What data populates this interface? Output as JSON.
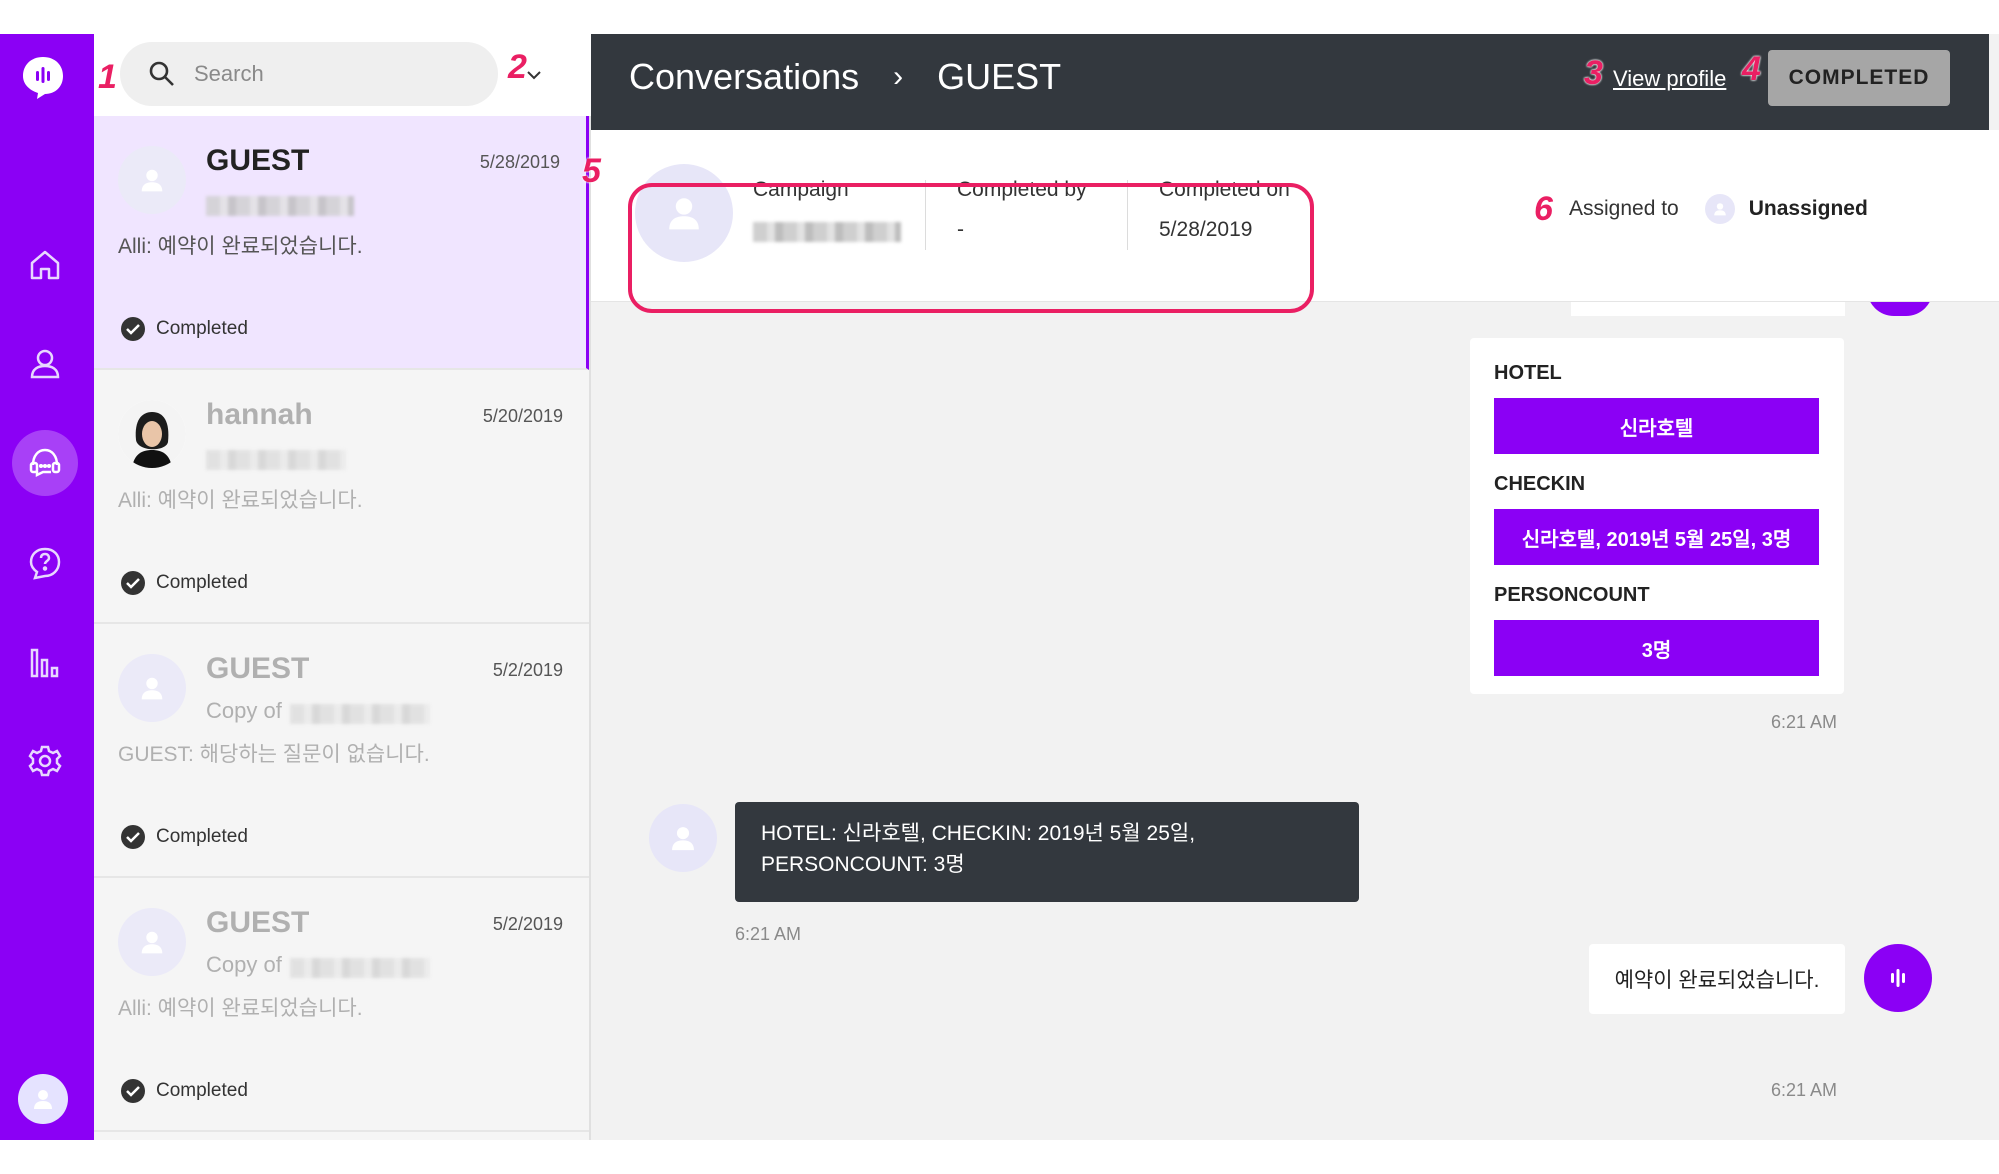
{
  "colors": {
    "brand": "#8b00f5",
    "topbar": "#33383e",
    "annotation": "#ea1f63"
  },
  "rail": {
    "items": [
      {
        "icon": "home-icon"
      },
      {
        "icon": "user-icon"
      },
      {
        "icon": "chat-icon",
        "active": true
      },
      {
        "icon": "help-icon"
      },
      {
        "icon": "analytics-icon"
      },
      {
        "icon": "settings-icon"
      }
    ]
  },
  "search": {
    "placeholder": "Search"
  },
  "conversations": [
    {
      "name": "GUEST",
      "date": "5/28/2019",
      "subtitle": "",
      "message": "Alli: 예약이 완료되었습니다.",
      "status": "Completed"
    },
    {
      "name": "hannah",
      "date": "5/20/2019",
      "subtitle": "",
      "message": "Alli: 예약이 완료되었습니다.",
      "status": "Completed"
    },
    {
      "name": "GUEST",
      "date": "5/2/2019",
      "subtitle": "Copy of",
      "message": "GUEST: 해당하는 질문이 없습니다.",
      "status": "Completed"
    },
    {
      "name": "GUEST",
      "date": "5/2/2019",
      "subtitle": "Copy of",
      "message": "Alli: 예약이 완료되었습니다.",
      "status": "Completed"
    }
  ],
  "header": {
    "section": "Conversations",
    "separator": "›",
    "current": "GUEST",
    "view_profile": "View profile",
    "status_button": "COMPLETED"
  },
  "info": {
    "campaign_label": "Campaign",
    "completed_by_label": "Completed by",
    "completed_by_value": "-",
    "completed_on_label": "Completed on",
    "completed_on_value": "5/28/2019",
    "assigned_label": "Assigned to",
    "assigned_value": "Unassigned"
  },
  "chat": {
    "card_fields": [
      {
        "label": "HOTEL",
        "value": "신라호텔"
      },
      {
        "label": "CHECKIN",
        "value": "신라호텔, 2019년 5월 25일, 3명"
      },
      {
        "label": "PERSONCOUNT",
        "value": "3명"
      }
    ],
    "card_time": "6:21 AM",
    "user_message_line1": "HOTEL: 신라호텔, CHECKIN: 2019년 5월 25일,",
    "user_message_line2": "PERSONCOUNT: 3명",
    "user_time": "6:21 AM",
    "bot_message": "예약이 완료되었습니다.",
    "bot_time": "6:21 AM"
  },
  "annotations": [
    "1",
    "2",
    "3",
    "4",
    "5",
    "6"
  ]
}
